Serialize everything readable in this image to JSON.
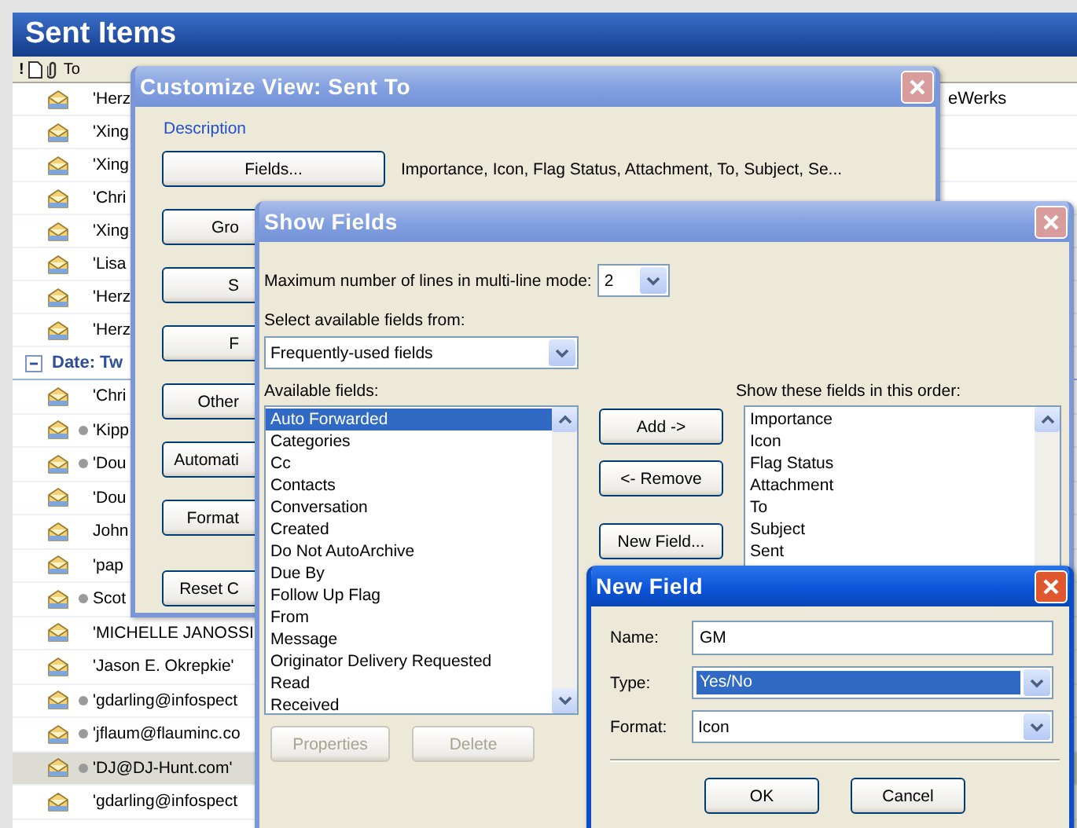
{
  "main_window": {
    "title": "Sent Items",
    "column_headers": {
      "importance": "!",
      "to": "To"
    },
    "messages_top": [
      {
        "to": "'Herz",
        "detail": "eWerks",
        "selected": false,
        "attachment": false
      },
      {
        "to": "'Xing",
        "selected": false,
        "attachment": false
      },
      {
        "to": "'Xing",
        "selected": false,
        "attachment": false
      },
      {
        "to": "'Chri",
        "selected": false,
        "attachment": false
      },
      {
        "to": "'Xing",
        "selected": false,
        "attachment": false
      },
      {
        "to": "'Lisa",
        "selected": false,
        "attachment": false
      },
      {
        "to": "'Herz",
        "selected": false,
        "attachment": false
      },
      {
        "to": "'Herz",
        "selected": false,
        "attachment": false
      }
    ],
    "group": {
      "label": "Date: Tw",
      "expanded": true
    },
    "messages": [
      {
        "to": "'Chri",
        "selected": false,
        "attachment": false
      },
      {
        "to": "'Kipp",
        "selected": false,
        "attachment": true
      },
      {
        "to": "'Dou",
        "selected": false,
        "attachment": true
      },
      {
        "to": "'Dou",
        "selected": false,
        "attachment": false
      },
      {
        "to": "John",
        "selected": false,
        "attachment": false
      },
      {
        "to": "'pap",
        "selected": false,
        "attachment": false
      },
      {
        "to": "Scot",
        "selected": false,
        "attachment": true
      },
      {
        "to": "'MICHELLE JANOSSI",
        "selected": false,
        "attachment": false
      },
      {
        "to": "'Jason E. Okrepkie'",
        "selected": false,
        "attachment": false
      },
      {
        "to": "'gdarling@infospect",
        "selected": false,
        "attachment": true
      },
      {
        "to": "'jflaum@flauminc.co",
        "selected": false,
        "attachment": true
      },
      {
        "to": "'DJ@DJ-Hunt.com'",
        "selected": true,
        "attachment": true
      },
      {
        "to": "'gdarling@infospect",
        "selected": false,
        "attachment": false
      }
    ]
  },
  "customize_view": {
    "title": "Customize View: Sent To",
    "active": false,
    "section": "Description",
    "buttons": [
      "Fields...",
      "Gro",
      "S",
      "F",
      "Other",
      "Automati",
      "Format",
      "Reset C"
    ],
    "fields_summary": "Importance, Icon, Flag Status, Attachment, To, Subject, Se..."
  },
  "show_fields": {
    "title": "Show Fields",
    "active": false,
    "max_lines_label": "Maximum number of lines in multi-line mode:",
    "max_lines": "2",
    "source_label": "Select available fields from:",
    "source": "Frequently-used fields",
    "available_label": "Available fields:",
    "available": [
      {
        "label": "Auto Forwarded",
        "selected": true
      },
      {
        "label": "Categories",
        "selected": false
      },
      {
        "label": "Cc",
        "selected": false
      },
      {
        "label": "Contacts",
        "selected": false
      },
      {
        "label": "Conversation",
        "selected": false
      },
      {
        "label": "Created",
        "selected": false
      },
      {
        "label": "Do Not AutoArchive",
        "selected": false
      },
      {
        "label": "Due By",
        "selected": false
      },
      {
        "label": "Follow Up Flag",
        "selected": false
      },
      {
        "label": "From",
        "selected": false
      },
      {
        "label": "Message",
        "selected": false
      },
      {
        "label": "Originator Delivery Requested",
        "selected": false
      },
      {
        "label": "Read",
        "selected": false
      },
      {
        "label": "Received",
        "selected": false
      }
    ],
    "properties_button": {
      "label": "Properties",
      "disabled": true
    },
    "delete_button": {
      "label": "Delete",
      "disabled": true
    },
    "add_button": "Add ->",
    "remove_button": "<- Remove",
    "new_field_button": "New Field...",
    "order_label": "Show these fields in this order:",
    "order": [
      "Importance",
      "Icon",
      "Flag Status",
      "Attachment",
      "To",
      "Subject",
      "Sent"
    ]
  },
  "new_field": {
    "title": "New Field",
    "active": true,
    "name_label": "Name:",
    "name": "GM",
    "type_label": "Type:",
    "type": "Yes/No",
    "type_highlighted": true,
    "format_label": "Format:",
    "format": "Icon",
    "ok_button": "OK",
    "cancel_button": "Cancel"
  }
}
